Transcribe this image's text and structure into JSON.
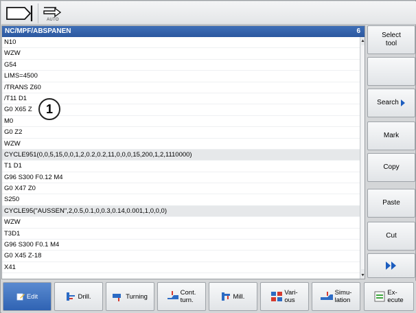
{
  "topbar": {
    "mode_icon_1": "jog-mode-icon",
    "mode_icon_2": "auto-mode-icon",
    "auto_label": "AUTO"
  },
  "editor": {
    "path": "NC/MPF/ABSPANEN",
    "count": "6",
    "lines": [
      "N10",
      "WZW",
      "G54",
      "LIMS=4500",
      "/TRANS Z60",
      "/T11 D1",
      "G0 X65 Z",
      "M0",
      "G0 Z2",
      "WZW",
      "CYCLE951(0,0,5,15,0,0,1,2,0.2,0.2,11,0,0,0,15,200,1,2,1110000)",
      "T1 D1",
      "G96 S300 F0.12 M4",
      "G0 X47 Z0",
      "S250",
      "CYCLE95(\"AUSSEN\",2,0.5,0.1,0,0.3,0.14,0.001,1,0,0,0)",
      "WZW",
      "T3D1",
      "G96 S300 F0.1 M4",
      "G0 X45 Z-18",
      "X41"
    ]
  },
  "callout": "1",
  "softkeys_right": {
    "select_tool_line1": "Select",
    "select_tool_line2": "tool",
    "blank": "",
    "search": "Search",
    "mark": "Mark",
    "copy": "Copy",
    "paste": "Paste",
    "cut": "Cut",
    "more_icon": "fast-forward-icon"
  },
  "softkeys_bottom": {
    "edit": "Edit",
    "drill": "Drill.",
    "turning": "Turning",
    "cont_turn_line1": "Cont.",
    "cont_turn_line2": "turn.",
    "mill": "Mill.",
    "various_line1": "Vari-",
    "various_line2": "ous",
    "simulation_line1": "Simu-",
    "simulation_line2": "lation",
    "execute_line1": "Ex-",
    "execute_line2": "ecute"
  },
  "colors": {
    "header_blue": "#2c58a0",
    "accent_blue": "#1c5dbf",
    "active_key": "#2f63b3"
  }
}
